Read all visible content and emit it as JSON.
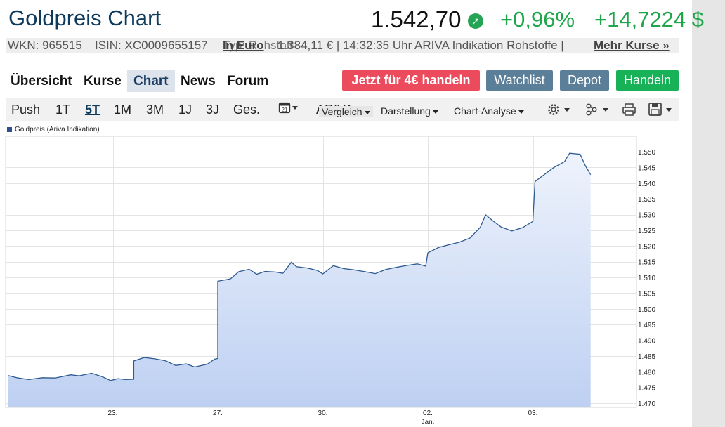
{
  "header": {
    "title": "Goldpreis Chart",
    "price": "1.542,70",
    "change_pct": "+0,96%",
    "change_abs": "+14,7224 $",
    "trend_icon": "arrow-up-right-icon",
    "colors": {
      "title": "#0e3a5c",
      "positive": "#1fa64a"
    }
  },
  "info": {
    "wkn": "WKN: 965515",
    "isin": "ISIN: XC0009655157",
    "euro_link": "In Euro",
    "euro_text": "Typ: Rohstoff",
    "euro_price": "1.384,11 € | 14:32:35 Uhr ARIVA Indikation Rohstoffe |",
    "more": "Mehr Kurse »"
  },
  "tabs": [
    "Übersicht",
    "Kurse",
    "Chart",
    "News",
    "Forum"
  ],
  "actions": {
    "trade4": "Jetzt für 4€ handeln",
    "watchlist": "Watchlist",
    "depot": "Depot",
    "handeln": "Handeln"
  },
  "toolbar": {
    "periods": [
      "Push",
      "1T",
      "5T",
      "1M",
      "3M",
      "1J",
      "3J",
      "Ges."
    ],
    "active_period": "5T",
    "calendar_day": "21",
    "exchange": "ARIVA",
    "vergleich": "Vergleich",
    "darstellung": "Darstellung",
    "analyse": "Chart-Analyse"
  },
  "chart_data": {
    "type": "area",
    "legend": "Goldpreis (Ariva Indikation)",
    "y_axis_position": "right",
    "grid": true,
    "ylim": [
      1467.5,
      1552.5
    ],
    "yticks": [
      "1.550",
      "1.545",
      "1.540",
      "1.535",
      "1.530",
      "1.525",
      "1.520",
      "1.515",
      "1.510",
      "1.505",
      "1.500",
      "1.495",
      "1.490",
      "1.485",
      "1.480",
      "1.475",
      "1.470"
    ],
    "ytick_values": [
      1550,
      1545,
      1540,
      1535,
      1530,
      1525,
      1520,
      1515,
      1510,
      1505,
      1500,
      1495,
      1490,
      1485,
      1480,
      1475,
      1470
    ],
    "xticks": [
      {
        "label": "23.",
        "sub": "",
        "t": 1
      },
      {
        "label": "27.",
        "sub": "",
        "t": 2
      },
      {
        "label": "30.",
        "sub": "",
        "t": 3
      },
      {
        "label": "02.",
        "sub": "Jan.",
        "t": 4
      },
      {
        "label": "03.",
        "sub": "",
        "t": 5
      }
    ],
    "xlim": [
      0,
      6.0
    ],
    "series": [
      {
        "values": [
          [
            0.0,
            1478.8
          ],
          [
            0.1,
            1478.0
          ],
          [
            0.2,
            1477.5
          ],
          [
            0.33,
            1478.1
          ],
          [
            0.45,
            1478.0
          ],
          [
            0.6,
            1479.0
          ],
          [
            0.68,
            1478.7
          ],
          [
            0.8,
            1479.5
          ],
          [
            0.9,
            1478.4
          ],
          [
            0.98,
            1477.2
          ],
          [
            1.05,
            1477.8
          ],
          [
            1.12,
            1477.5
          ],
          [
            1.2,
            1477.6
          ],
          [
            1.2,
            1483.4
          ],
          [
            1.3,
            1484.5
          ],
          [
            1.4,
            1484.1
          ],
          [
            1.5,
            1483.5
          ],
          [
            1.6,
            1482.0
          ],
          [
            1.7,
            1482.5
          ],
          [
            1.78,
            1481.5
          ],
          [
            1.9,
            1482.4
          ],
          [
            1.97,
            1484.0
          ],
          [
            2.0,
            1484.2
          ],
          [
            2.0,
            1508.8
          ],
          [
            2.12,
            1509.5
          ],
          [
            2.2,
            1511.8
          ],
          [
            2.3,
            1512.6
          ],
          [
            2.37,
            1511.0
          ],
          [
            2.45,
            1511.9
          ],
          [
            2.55,
            1511.7
          ],
          [
            2.62,
            1511.3
          ],
          [
            2.7,
            1514.8
          ],
          [
            2.75,
            1513.4
          ],
          [
            2.85,
            1513.0
          ],
          [
            2.95,
            1512.2
          ],
          [
            3.0,
            1511.1
          ],
          [
            3.1,
            1513.7
          ],
          [
            3.2,
            1512.8
          ],
          [
            3.3,
            1512.4
          ],
          [
            3.4,
            1511.8
          ],
          [
            3.5,
            1511.2
          ],
          [
            3.6,
            1512.5
          ],
          [
            3.7,
            1513.2
          ],
          [
            3.8,
            1513.8
          ],
          [
            3.9,
            1514.3
          ],
          [
            3.98,
            1513.6
          ],
          [
            4.0,
            1517.8
          ],
          [
            4.1,
            1519.5
          ],
          [
            4.2,
            1520.4
          ],
          [
            4.3,
            1521.2
          ],
          [
            4.4,
            1522.5
          ],
          [
            4.5,
            1526.0
          ],
          [
            4.55,
            1529.9
          ],
          [
            4.62,
            1528.0
          ],
          [
            4.7,
            1526.0
          ],
          [
            4.8,
            1524.8
          ],
          [
            4.9,
            1525.8
          ],
          [
            5.0,
            1527.8
          ],
          [
            5.02,
            1540.5
          ],
          [
            5.1,
            1542.5
          ],
          [
            5.2,
            1545.0
          ],
          [
            5.3,
            1546.8
          ],
          [
            5.35,
            1549.5
          ],
          [
            5.45,
            1549.2
          ],
          [
            5.5,
            1545.5
          ],
          [
            5.55,
            1542.7
          ]
        ]
      }
    ]
  }
}
